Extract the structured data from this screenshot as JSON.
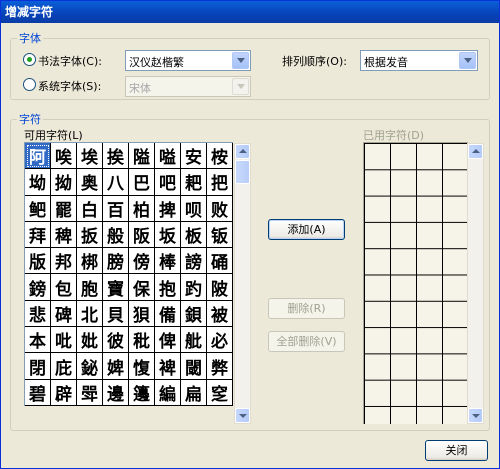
{
  "window": {
    "title": "增减字符"
  },
  "font_group": {
    "legend": "字体",
    "calligraphy_radio": {
      "label": "书法字体(C):",
      "selected": true
    },
    "calligraphy_combo": {
      "value": "汉仪赵楷繁"
    },
    "system_radio": {
      "label": "系统字体(S):",
      "selected": false
    },
    "system_combo": {
      "value": "宋体"
    },
    "sort_label": "排列顺序(O):",
    "sort_combo": {
      "value": "根据发音"
    }
  },
  "char_group": {
    "legend": "字符",
    "available_label": "可用字符(L)",
    "used_label": "已用字符(D)",
    "available_chars": [
      "阿",
      "唉",
      "埃",
      "挨",
      "隘",
      "嗌",
      "安",
      "桉",
      "坳",
      "拗",
      "奥",
      "八",
      "巴",
      "吧",
      "耙",
      "把",
      "鲃",
      "罷",
      "白",
      "百",
      "柏",
      "捭",
      "呗",
      "败",
      "拜",
      "稗",
      "扳",
      "般",
      "阪",
      "坂",
      "板",
      "钣",
      "版",
      "邦",
      "梆",
      "膀",
      "傍",
      "棒",
      "謗",
      "硧",
      "鎊",
      "包",
      "胞",
      "寶",
      "保",
      "抱",
      "趵",
      "陂",
      "悲",
      "碑",
      "北",
      "貝",
      "狽",
      "備",
      "鋇",
      "被",
      "本",
      "吡",
      "妣",
      "彼",
      "秕",
      "俾",
      "舭",
      "必",
      "閉",
      "庇",
      "鉍",
      "婢",
      "愎",
      "裨",
      "閾",
      "弊",
      "碧",
      "辟",
      "斝",
      "邊",
      "籩",
      "編",
      "扁",
      "窆"
    ],
    "selected_index": 0
  },
  "buttons": {
    "add": "添加(A)",
    "remove": "删除(R)",
    "remove_all": "全部删除(V)",
    "close": "关闭"
  }
}
